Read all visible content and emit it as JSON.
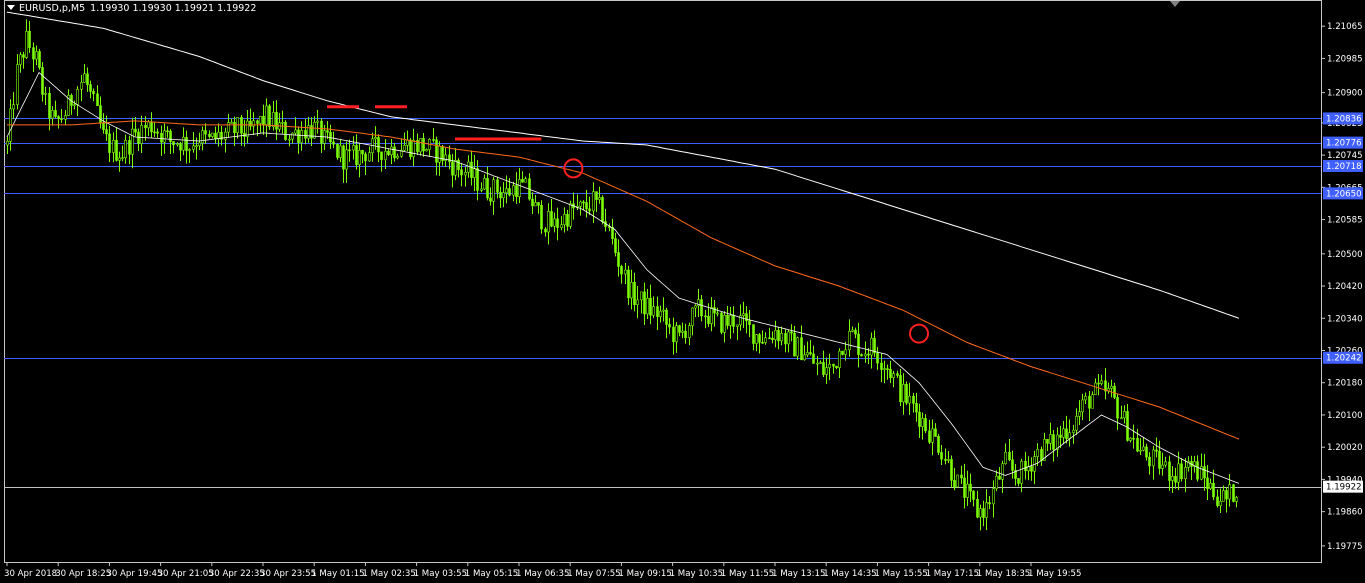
{
  "header": {
    "symbol": "EURUSD,p,M5",
    "ohlc": "1.19930 1.19930 1.19921 1.19922"
  },
  "colors": {
    "background": "#000000",
    "candles": "#7CFC00",
    "ma_fast": "#FFFFFF",
    "ma_mid": "#FF6A1A",
    "ma_slow": "#FFFFFF",
    "hlines": "#3F5FFF",
    "bid_line": "#C0C0C0",
    "markers": "#FF2020"
  },
  "chart_data": {
    "type": "line",
    "title": "",
    "instrument": "EURUSD",
    "timeframe": "M5",
    "ylim": [
      1.19735,
      1.2113
    ],
    "y_ticks": [
      "1.21065",
      "1.20985",
      "1.20900",
      "1.20825",
      "1.20745",
      "1.20665",
      "1.20585",
      "1.20500",
      "1.20420",
      "1.20340",
      "1.20260",
      "1.20180",
      "1.20100",
      "1.20020",
      "1.19940",
      "1.19860",
      "1.19775"
    ],
    "x_ticks": [
      "30 Apr 2018",
      "30 Apr 18:25",
      "30 Apr 19:45",
      "30 Apr 21:05",
      "30 Apr 22:35",
      "30 Apr 23:55",
      "1 May 01:15",
      "1 May 02:35",
      "1 May 03:55",
      "1 May 05:15",
      "1 May 06:35",
      "1 May 07:55",
      "1 May 09:15",
      "1 May 10:35",
      "1 May 11:55",
      "1 May 13:15",
      "1 May 14:35",
      "1 May 15:55",
      "1 May 17:15",
      "1 May 18:35",
      "1 May 19:55"
    ],
    "bars_per_tick": 16,
    "grid": false,
    "horizontal_levels": [
      {
        "label": "1.20836",
        "value": 1.20836
      },
      {
        "label": "1.20776",
        "value": 1.20776
      },
      {
        "label": "1.20718",
        "value": 1.20718
      },
      {
        "label": "1.20650",
        "value": 1.2065
      },
      {
        "label": "1.20242",
        "value": 1.20242
      }
    ],
    "bid": {
      "label": "1.19922",
      "value": 1.19922
    },
    "close_path": [
      [
        0,
        1.2077
      ],
      [
        3,
        1.2095
      ],
      [
        6,
        1.2103
      ],
      [
        9,
        1.2098
      ],
      [
        12,
        1.2087
      ],
      [
        15,
        1.2082
      ],
      [
        18,
        1.2085
      ],
      [
        21,
        1.209
      ],
      [
        24,
        1.2094
      ],
      [
        27,
        1.2087
      ],
      [
        30,
        1.2079
      ],
      [
        33,
        1.2076
      ],
      [
        36,
        1.2075
      ],
      [
        39,
        1.2079
      ],
      [
        42,
        1.2081
      ],
      [
        45,
        1.2082
      ],
      [
        48,
        1.208
      ],
      [
        51,
        1.2078
      ],
      [
        54,
        1.2078
      ],
      [
        57,
        1.2077
      ],
      [
        60,
        1.2079
      ],
      [
        63,
        1.2078
      ],
      [
        66,
        1.2079
      ],
      [
        69,
        1.208
      ],
      [
        72,
        1.2081
      ],
      [
        75,
        1.208
      ],
      [
        78,
        1.2082
      ],
      [
        81,
        1.2084
      ],
      [
        84,
        1.2082
      ],
      [
        87,
        1.208
      ],
      [
        90,
        1.208
      ],
      [
        93,
        1.2081
      ],
      [
        96,
        1.2081
      ],
      [
        99,
        1.2078
      ],
      [
        102,
        1.2076
      ],
      [
        105,
        1.2074
      ],
      [
        108,
        1.2074
      ],
      [
        111,
        1.2075
      ],
      [
        114,
        1.2076
      ],
      [
        117,
        1.2076
      ],
      [
        120,
        1.2076
      ],
      [
        123,
        1.2077
      ],
      [
        126,
        1.2077
      ],
      [
        129,
        1.2077
      ],
      [
        132,
        1.2076
      ],
      [
        135,
        1.2075
      ],
      [
        138,
        1.2073
      ],
      [
        141,
        1.2071
      ],
      [
        144,
        1.207
      ],
      [
        147,
        1.2068
      ],
      [
        150,
        1.2066
      ],
      [
        153,
        1.2066
      ],
      [
        156,
        1.2065
      ],
      [
        159,
        1.2067
      ],
      [
        162,
        1.2066
      ],
      [
        165,
        1.2061
      ],
      [
        168,
        1.2058
      ],
      [
        171,
        1.2057
      ],
      [
        174,
        1.2059
      ],
      [
        177,
        1.2061
      ],
      [
        180,
        1.2061
      ],
      [
        183,
        1.2063
      ],
      [
        186,
        1.206
      ],
      [
        189,
        1.2053
      ],
      [
        192,
        1.2046
      ],
      [
        195,
        1.204
      ],
      [
        198,
        1.2038
      ],
      [
        201,
        1.2036
      ],
      [
        204,
        1.2035
      ],
      [
        207,
        1.2031
      ],
      [
        210,
        1.2029
      ],
      [
        213,
        1.2033
      ],
      [
        216,
        1.2036
      ],
      [
        219,
        1.2035
      ],
      [
        222,
        1.2033
      ],
      [
        225,
        1.2033
      ],
      [
        228,
        1.2034
      ],
      [
        231,
        1.2032
      ],
      [
        234,
        1.203
      ],
      [
        237,
        1.2029
      ],
      [
        240,
        1.2031
      ],
      [
        243,
        1.2029
      ],
      [
        246,
        1.2027
      ],
      [
        249,
        1.2026
      ],
      [
        252,
        1.2023
      ],
      [
        255,
        1.2021
      ],
      [
        258,
        1.2022
      ],
      [
        261,
        1.2028
      ],
      [
        264,
        1.203
      ],
      [
        267,
        1.2026
      ],
      [
        270,
        1.2027
      ],
      [
        273,
        1.2024
      ],
      [
        276,
        1.2021
      ],
      [
        279,
        1.2016
      ],
      [
        282,
        1.2013
      ],
      [
        285,
        1.201
      ],
      [
        288,
        1.2006
      ],
      [
        291,
        1.2003
      ],
      [
        294,
        1.1998
      ],
      [
        297,
        1.1993
      ],
      [
        300,
        1.199
      ],
      [
        303,
        1.1986
      ],
      [
        306,
        1.1987
      ],
      [
        309,
        1.1993
      ],
      [
        312,
        1.1998
      ],
      [
        315,
        1.1995
      ],
      [
        318,
        1.1996
      ],
      [
        321,
        1.2
      ],
      [
        324,
        1.2002
      ],
      [
        327,
        1.2003
      ],
      [
        330,
        1.2006
      ],
      [
        333,
        1.2008
      ],
      [
        336,
        1.2012
      ],
      [
        339,
        1.2015
      ],
      [
        342,
        1.2016
      ],
      [
        345,
        1.2015
      ],
      [
        348,
        1.201
      ],
      [
        351,
        1.2005
      ],
      [
        354,
        1.2001
      ],
      [
        357,
        1.1999
      ],
      [
        360,
        1.1998
      ],
      [
        363,
        1.1996
      ],
      [
        366,
        1.1996
      ],
      [
        369,
        1.1998
      ],
      [
        372,
        1.1996
      ],
      [
        375,
        1.1993
      ],
      [
        378,
        1.199
      ],
      [
        381,
        1.1989
      ],
      [
        384,
        1.1992
      ]
    ],
    "series": [
      {
        "values": [
          [
            0,
            1.2079
          ],
          [
            10,
            1.2095
          ],
          [
            20,
            1.2088
          ],
          [
            30,
            1.2083
          ],
          [
            40,
            1.2079
          ],
          [
            60,
            1.2078
          ],
          [
            80,
            1.208
          ],
          [
            100,
            1.2079
          ],
          [
            120,
            1.2076
          ],
          [
            140,
            1.2073
          ],
          [
            160,
            1.2067
          ],
          [
            180,
            1.2061
          ],
          [
            190,
            1.2056
          ],
          [
            200,
            1.2046
          ],
          [
            210,
            1.2039
          ],
          [
            230,
            1.2034
          ],
          [
            250,
            1.203
          ],
          [
            265,
            1.2027
          ],
          [
            275,
            1.2025
          ],
          [
            285,
            1.2018
          ],
          [
            295,
            1.2008
          ],
          [
            305,
            1.1997
          ],
          [
            312,
            1.1995
          ],
          [
            322,
            1.1998
          ],
          [
            332,
            1.2004
          ],
          [
            342,
            1.201
          ],
          [
            350,
            1.2007
          ],
          [
            360,
            1.2002
          ],
          [
            372,
            1.1997
          ],
          [
            385,
            1.1993
          ]
        ]
      },
      {
        "values": [
          [
            0,
            1.2082
          ],
          [
            20,
            1.2082
          ],
          [
            40,
            1.2083
          ],
          [
            60,
            1.2082
          ],
          [
            80,
            1.2082
          ],
          [
            100,
            1.2081
          ],
          [
            120,
            1.2079
          ],
          [
            140,
            1.2076
          ],
          [
            160,
            1.2074
          ],
          [
            180,
            1.207
          ],
          [
            200,
            1.2063
          ],
          [
            220,
            1.2054
          ],
          [
            240,
            1.2047
          ],
          [
            260,
            1.2042
          ],
          [
            280,
            1.2036
          ],
          [
            300,
            1.2028
          ],
          [
            320,
            1.2022
          ],
          [
            340,
            1.2017
          ],
          [
            360,
            1.2012
          ],
          [
            385,
            1.2004
          ]
        ]
      },
      {
        "values": [
          [
            0,
            1.211
          ],
          [
            30,
            1.2106
          ],
          [
            60,
            1.2099
          ],
          [
            80,
            1.2093
          ],
          [
            100,
            1.2088
          ],
          [
            120,
            1.2084
          ],
          [
            140,
            1.2082
          ],
          [
            160,
            1.208
          ],
          [
            180,
            1.2078
          ],
          [
            200,
            1.2077
          ],
          [
            220,
            1.2074
          ],
          [
            240,
            1.2071
          ],
          [
            260,
            1.2066
          ],
          [
            280,
            1.2061
          ],
          [
            300,
            1.2056
          ],
          [
            320,
            1.2051
          ],
          [
            340,
            1.2046
          ],
          [
            360,
            1.2041
          ],
          [
            385,
            1.2034
          ]
        ]
      }
    ],
    "annotations": [
      {
        "type": "segment",
        "x": [
          100,
          110
        ],
        "value": 1.20865
      },
      {
        "type": "segment",
        "x": [
          115,
          125
        ],
        "value": 1.20865
      },
      {
        "type": "segment",
        "x": [
          140,
          167
        ],
        "value": 1.20785
      },
      {
        "type": "circle",
        "x": 177,
        "value": 1.20712
      },
      {
        "type": "circle",
        "x": 285,
        "value": 1.20302
      }
    ]
  }
}
